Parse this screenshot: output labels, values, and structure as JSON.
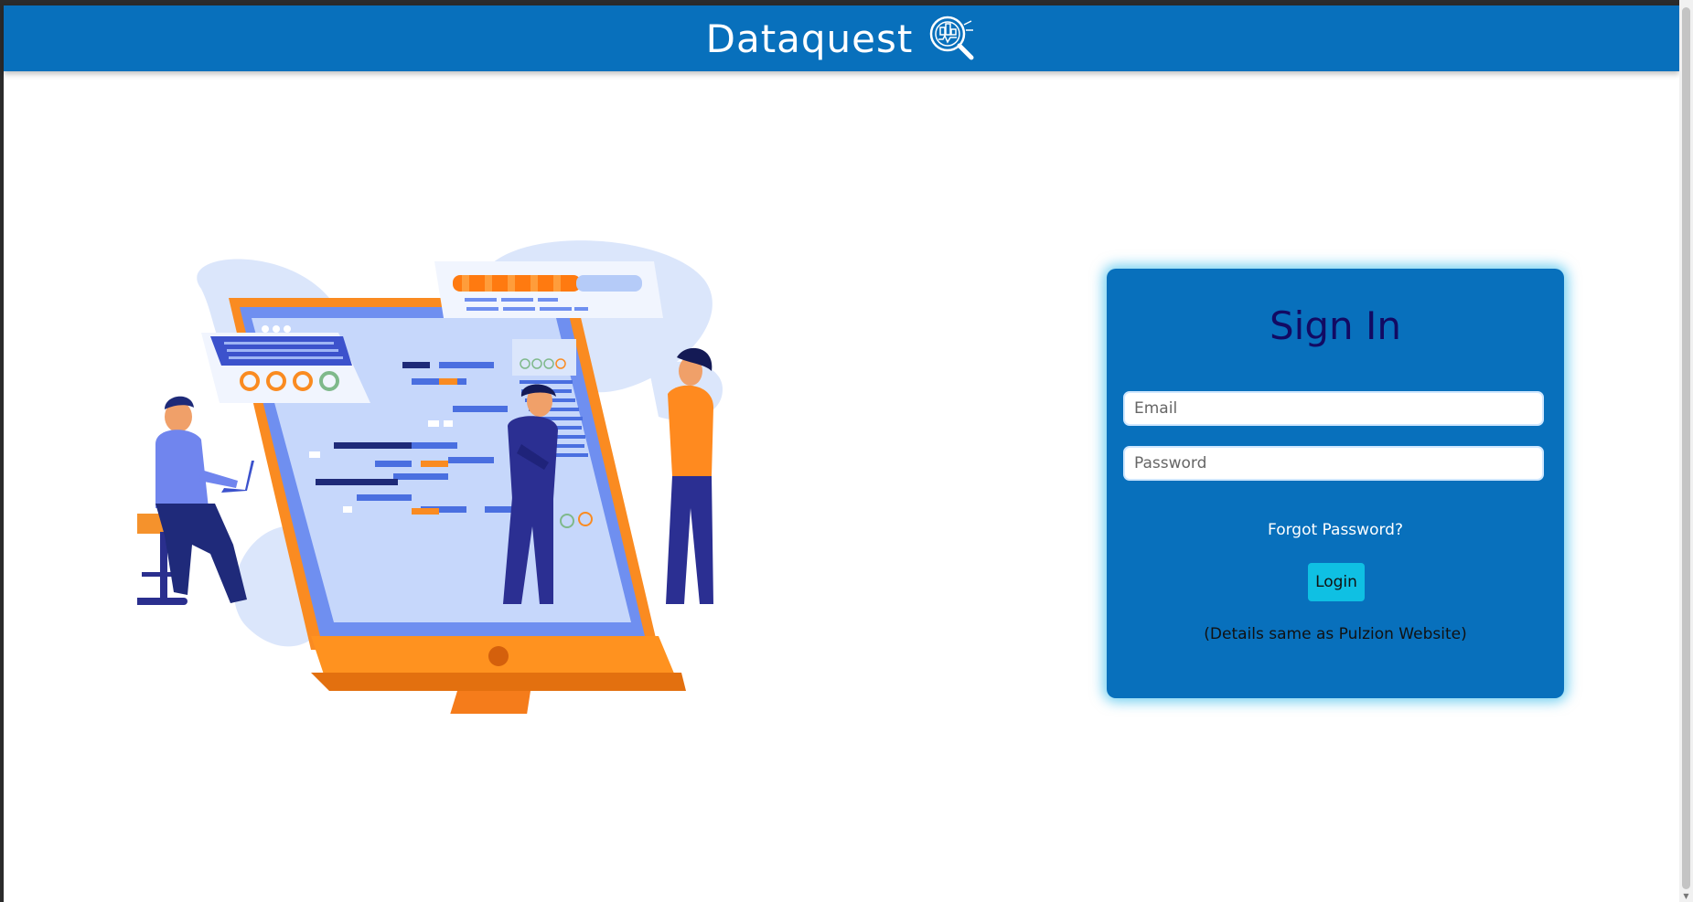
{
  "header": {
    "brand": "Dataquest",
    "logo_icon": "magnifier-chart-logo",
    "bg_color": "#0870bc"
  },
  "signin": {
    "title": "Sign In",
    "email_placeholder": "Email",
    "password_placeholder": "Password",
    "forgot_label": "Forgot Password?",
    "login_label": "Login",
    "note": "(Details same as Pulzion Website)",
    "card_color": "#0870bc",
    "button_color": "#0fc0e3"
  },
  "illustration": {
    "icon": "data-analytics-team-illustration"
  }
}
